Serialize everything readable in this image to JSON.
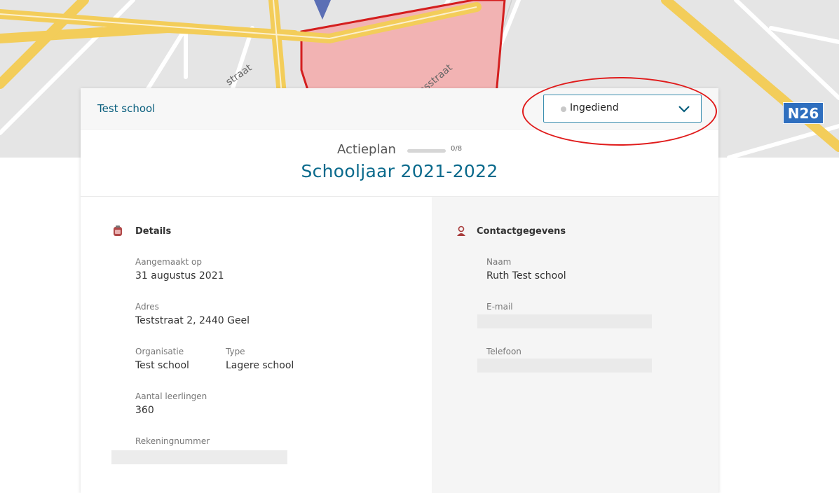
{
  "map": {
    "road_badge": "N26"
  },
  "header": {
    "school_name": "Test school",
    "status": {
      "selected": "Ingediend"
    }
  },
  "plan": {
    "label": "Actieplan",
    "progress_text": "0/8",
    "progress_fraction": 0,
    "year": "Schooljaar 2021-2022"
  },
  "details": {
    "title": "Details",
    "created_label": "Aangemaakt op",
    "created_value": "31 augustus 2021",
    "address_label": "Adres",
    "address_value": "Teststraat 2, 2440 Geel",
    "org_label": "Organisatie",
    "org_value": "Test school",
    "type_label": "Type",
    "type_value": "Lagere school",
    "students_label": "Aantal leerlingen",
    "students_value": "360",
    "account_label": "Rekeningnummer"
  },
  "contact": {
    "title": "Contactgegevens",
    "name_label": "Naam",
    "name_value": "Ruth Test school",
    "email_label": "E-mail",
    "phone_label": "Telefoon"
  },
  "colors": {
    "accent": "#0a5f7e",
    "highlight": "#e01b1b",
    "road": "#f3cd5a",
    "zone_fill": "#f2b3b3",
    "zone_stroke": "#d41e1e"
  }
}
